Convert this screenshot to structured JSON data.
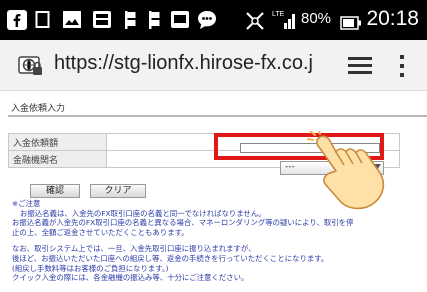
{
  "status_bar": {
    "icons": [
      "facebook-icon",
      "notification-icon",
      "gallery-icon",
      "app-icon",
      "flag-icon",
      "flag-icon",
      "chat-icon",
      "bubble-icon"
    ],
    "network": "vibrate-icon",
    "battery_percent": "80%",
    "time": "20:18"
  },
  "browser": {
    "url": "https://stg-lionfx.hirose-fx.co.j"
  },
  "page": {
    "title": "入金依頼入力",
    "form": {
      "amount_label": "入金依頼額",
      "bank_label": "金融機関名",
      "bank_value": "---"
    },
    "buttons": {
      "confirm": "確認",
      "clear": "クリア"
    },
    "notes": [
      "※ご注意",
      "お振込名義は、入金先のFX取引口座の名義と同一でなければなりません。",
      "お振込名義が入金先のFX取引口座の名義と異なる場合、マネーロンダリング等の疑いにより、取引を停",
      "止の上、全額ご返金させていただくこともあります。",
      "なお、取引システム上では、一旦、入金先取引口座に振り込まれますが、",
      "後ほど、お振込いただいた口座への組戻し等、返金の手続きを行っていただくことになります。",
      "(組戻し手数料等はお客様のご負担になります。)",
      "クイック入金の際には、各金融機の振込み等、十分にご注意ください。"
    ]
  },
  "colors": {
    "highlight": "#e01818",
    "notes_text": "#2a3aa8"
  }
}
